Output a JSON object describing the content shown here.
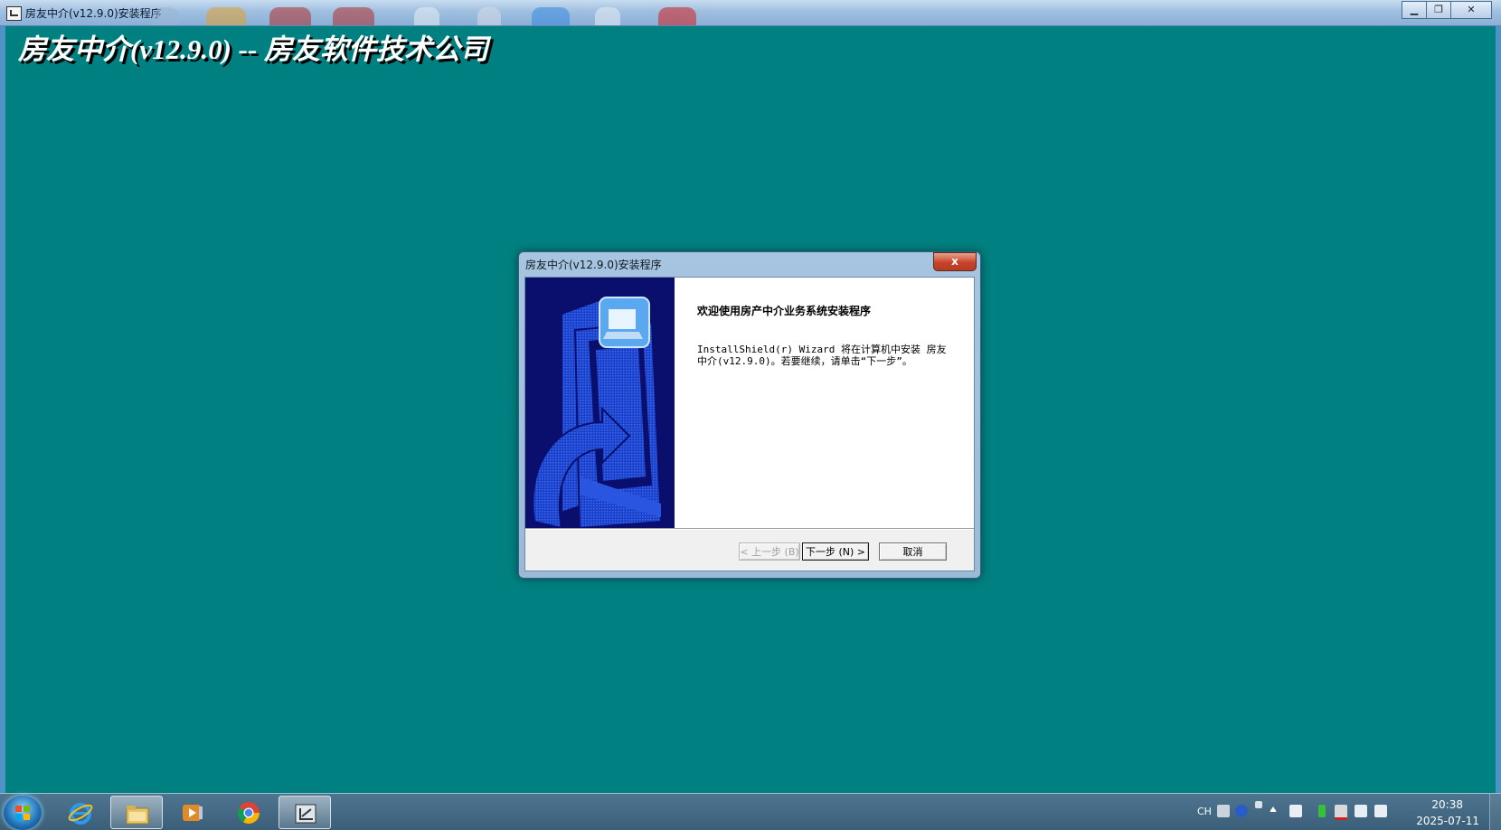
{
  "window": {
    "title": "房友中介(v12.9.0)安装程序",
    "minimize_glyph": "▁",
    "restore_glyph": "❐",
    "close_glyph": "✕"
  },
  "banner": {
    "text": "房友中介(v12.9.0) -- 房友软件技术公司"
  },
  "dialog": {
    "title": "房友中介(v12.9.0)安装程序",
    "close_glyph": "x",
    "heading": "欢迎使用房产中介业务系统安装程序",
    "body": "InstallShield(r) Wizard 将在计算机中安装 房友中介(v12.9.0)。若要继续，请单击“下一步”。",
    "buttons": {
      "back": "< 上一步 (B)",
      "next": "下一步 (N) >",
      "cancel": "取消"
    }
  },
  "taskbar": {
    "apps": [
      "start-button",
      "internet-explorer-icon",
      "file-explorer-icon",
      "media-player-icon",
      "chrome-icon",
      "installer-icon"
    ],
    "tray": {
      "lang": "CH",
      "time": "20:38",
      "date": "2025-07-11"
    }
  },
  "colors": {
    "desktop": "#008080",
    "banner_text": "#ffffff",
    "art_background": "#0a0f6e"
  }
}
